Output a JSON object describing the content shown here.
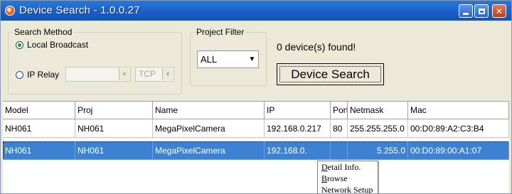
{
  "window": {
    "title": "Device Search - 1.0.0.27"
  },
  "search_method": {
    "legend": "Search Method",
    "local_broadcast_label": "Local Broadcast",
    "local_broadcast_selected": true,
    "ip_relay_label": "IP Relay",
    "ip_relay_selected": false,
    "ip_value": "",
    "protocol_value": "TCP"
  },
  "project_filter": {
    "legend": "Project Filter",
    "value": "ALL"
  },
  "status_text": "0 device(s) found!",
  "search_button_label": "Device Search",
  "table": {
    "columns": [
      "Model",
      "Proj",
      "Name",
      "IP",
      "Port",
      "Netmask",
      "Mac"
    ],
    "rows": [
      {
        "model": "NH061",
        "proj": "NH061",
        "name": "MegaPixelCamera",
        "ip": "192.168.0.217",
        "port": "80",
        "netmask": "255.255.255.0",
        "mac": "00:D0:89:A2:C3:B4",
        "selected": false
      },
      {
        "model": "NH061",
        "proj": "NH061",
        "name": "MegaPixelCamera",
        "ip": "192.168.0.",
        "port": "",
        "netmask": "5.255.0",
        "mac": "00:D0:89:00:A1:07",
        "selected": true
      }
    ]
  },
  "context_menu": {
    "items": [
      {
        "mnemonic": "D",
        "rest": "etail Info."
      },
      {
        "mnemonic": "B",
        "rest": "rowse"
      },
      {
        "mnemonic": "N",
        "rest": "etwork Setup"
      }
    ]
  },
  "colors": {
    "title_bar": "#1c5fc9",
    "selection": "#3d82d2",
    "radio_dot": "#21a121",
    "window_bg": "#ece9d8"
  },
  "icons": {
    "app": "device-search-app-icon",
    "minimize": "minimize-icon",
    "maximize": "maximize-icon",
    "close": "close-icon",
    "dropdown": "chevron-down-icon"
  }
}
